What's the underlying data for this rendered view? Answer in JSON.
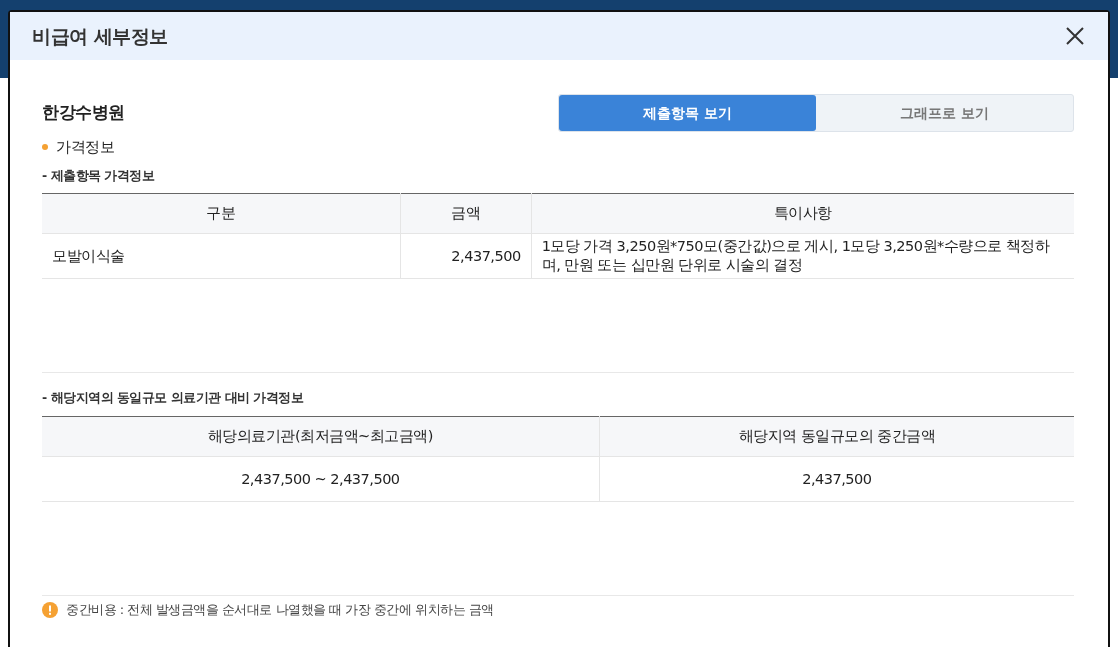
{
  "modal": {
    "title": "비급여 세부정보"
  },
  "hospital": "한강수병원",
  "tabs": [
    {
      "label": "제출항목 보기",
      "selected": true
    },
    {
      "label": "그래프로 보기",
      "selected": false
    }
  ],
  "section": "가격정보",
  "items_table": {
    "caption": "- 제출항목 가격정보",
    "columns": [
      "구분",
      "금액",
      "특이사항"
    ],
    "rows": [
      [
        "모발이식술",
        "2,437,500",
        "1모당 가격 3,250원*750모(중간값)으로 게시, 1모당 3,250원*수량으로 책정하며, 만원 또는 십만원 단위로 시술의 결정"
      ]
    ]
  },
  "compare_table": {
    "caption": "- 해당지역의 동일규모 의료기관 대비 가격정보",
    "columns": [
      "해당의료기관(최저금액~최고금액)",
      "해당지역 동일규모의 중간금액"
    ],
    "rows": [
      [
        "2,437,500 ~ 2,437,500",
        "2,437,500"
      ]
    ]
  },
  "note": {
    "text": "중간비용 : 전체 발생금액을 순서대로 나열했을 때 가장 중간에 위치하는 금액"
  }
}
